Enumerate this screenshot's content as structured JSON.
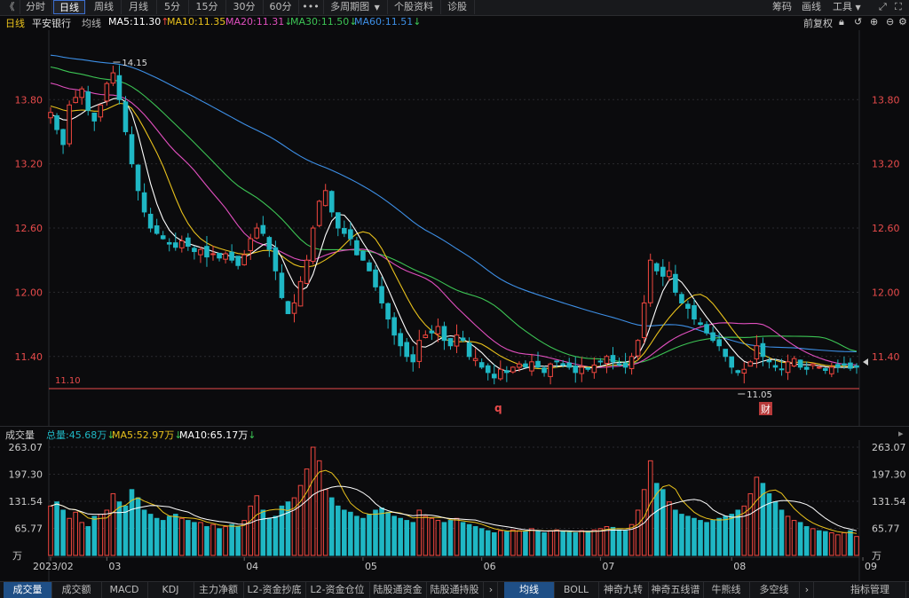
{
  "toolbar": {
    "back": "《",
    "periods": [
      "分时",
      "日线",
      "周线",
      "月线",
      "5分",
      "15分",
      "30分",
      "60分"
    ],
    "more": "•••",
    "multi_period": "多周期图",
    "stock_info": "个股资料",
    "diagnose": "诊股",
    "chips": "筹码",
    "draw": "画线",
    "tools": "工具"
  },
  "info": {
    "period": "日线",
    "stock_name": "平安银行",
    "ma_label": "均线",
    "ma5": "MA5:11.30",
    "ma10": "MA10:11.35",
    "ma20": "MA20:11.31",
    "ma30": "MA30:11.50",
    "ma60": "MA60:11.51",
    "adjust": "前复权",
    "arrow_up": "↑",
    "arrow_down": "↓"
  },
  "volume_header": {
    "title": "成交量",
    "total": "总量:45.68万",
    "ma5": "MA5:52.97万",
    "ma10": "MA10:65.17万",
    "arrow": "↓"
  },
  "bottom_tabs": [
    "成交量",
    "成交额",
    "MACD",
    "KDJ",
    "主力净额",
    "L2-资金抄底",
    "L2-资金仓位",
    "陆股通资金",
    "陆股通持股"
  ],
  "indicator_tabs": [
    "均线",
    "BOLL",
    "神奇九转",
    "神奇五线谱",
    "牛熊线",
    "多空线"
  ],
  "indicator_manage": "指标管理",
  "markers": {
    "q": "q",
    "cai": "财"
  },
  "colors": {
    "up": "#f0473f",
    "down": "#1fb7c4",
    "ma5": "#ffffff",
    "ma10": "#e8c11c",
    "ma20": "#e04fbe",
    "ma30": "#3cc454",
    "ma60": "#3d8fe6",
    "grid": "#2a2a2e",
    "label": "#e84b4b"
  },
  "chart_data": {
    "type": "candlestick",
    "x_tick_labels": [
      "2023/02",
      "03",
      "04",
      "05",
      "06",
      "07",
      "08",
      "09"
    ],
    "x_tick_index": [
      0,
      9,
      31,
      50,
      69,
      88,
      109,
      130
    ],
    "price_ticks": [
      "13.80",
      "13.20",
      "12.60",
      "12.00",
      "11.40"
    ],
    "price_tick_values": [
      13.8,
      13.2,
      12.6,
      12.0,
      11.4
    ],
    "ylim": [
      11.05,
      14.2
    ],
    "annotation_high": "14.15",
    "annotation_low": "11.05",
    "support_label": "11.10",
    "support_value": 11.1,
    "volume_ticks": [
      "263.07",
      "197.30",
      "131.54",
      "65.77"
    ],
    "volume_tick_values": [
      263.07,
      197.3,
      131.54,
      65.77
    ],
    "volume_unit": "万",
    "vol_ylim": [
      0,
      263.07
    ],
    "closes": [
      13.68,
      13.52,
      13.38,
      13.75,
      13.82,
      13.9,
      13.7,
      13.6,
      13.75,
      13.95,
      14.05,
      13.8,
      13.5,
      13.2,
      12.95,
      12.75,
      12.6,
      12.55,
      12.5,
      12.45,
      12.42,
      12.48,
      12.43,
      12.38,
      12.4,
      12.33,
      12.36,
      12.32,
      12.36,
      12.3,
      12.25,
      12.35,
      12.5,
      12.6,
      12.55,
      12.4,
      12.2,
      11.95,
      11.8,
      11.9,
      12.1,
      12.3,
      12.6,
      12.85,
      12.95,
      12.75,
      12.6,
      12.55,
      12.5,
      12.35,
      12.3,
      12.2,
      12.05,
      11.9,
      11.75,
      11.6,
      11.5,
      11.4,
      11.35,
      11.55,
      11.6,
      11.62,
      11.68,
      11.55,
      11.5,
      11.6,
      11.55,
      11.4,
      11.38,
      11.3,
      11.25,
      11.2,
      11.28,
      11.25,
      11.3,
      11.33,
      11.3,
      11.35,
      11.3,
      11.25,
      11.33,
      11.35,
      11.32,
      11.3,
      11.25,
      11.3,
      11.28,
      11.32,
      11.35,
      11.4,
      11.35,
      11.32,
      11.3,
      11.4,
      11.55,
      11.9,
      12.3,
      12.2,
      12.15,
      12.2,
      12.0,
      11.9,
      11.85,
      11.75,
      11.7,
      11.62,
      11.55,
      11.5,
      11.4,
      11.3,
      11.25,
      11.28,
      11.35,
      11.5,
      11.4,
      11.35,
      11.3,
      11.28,
      11.35,
      11.38,
      11.3,
      11.28,
      11.33,
      11.3,
      11.27,
      11.3,
      11.3,
      11.32,
      11.29,
      11.3
    ],
    "volumes": [
      120,
      130,
      110,
      90,
      105,
      80,
      70,
      95,
      100,
      110,
      150,
      130,
      120,
      160,
      140,
      110,
      100,
      90,
      85,
      95,
      100,
      90,
      85,
      80,
      80,
      70,
      75,
      65,
      70,
      75,
      70,
      85,
      120,
      145,
      110,
      90,
      95,
      120,
      130,
      140,
      170,
      210,
      263,
      230,
      160,
      140,
      120,
      110,
      105,
      95,
      90,
      100,
      110,
      115,
      105,
      95,
      90,
      85,
      80,
      110,
      95,
      90,
      85,
      80,
      85,
      90,
      80,
      75,
      70,
      65,
      60,
      55,
      60,
      58,
      62,
      60,
      58,
      65,
      60,
      55,
      60,
      62,
      58,
      56,
      55,
      60,
      58,
      62,
      65,
      70,
      68,
      62,
      60,
      75,
      110,
      160,
      230,
      175,
      160,
      130,
      110,
      100,
      95,
      90,
      85,
      80,
      85,
      90,
      95,
      100,
      110,
      120,
      150,
      190,
      175,
      150,
      130,
      110,
      95,
      85,
      80,
      70,
      65,
      60,
      58,
      55,
      50,
      55,
      60,
      46
    ]
  }
}
